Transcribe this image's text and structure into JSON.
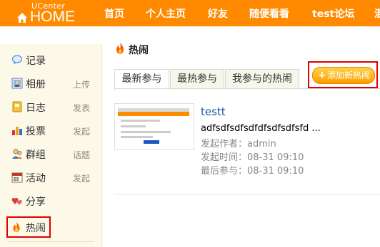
{
  "header": {
    "logo_small": "UCenter",
    "logo_big": "HOME",
    "nav": [
      {
        "label": "首页"
      },
      {
        "label": "个人主页"
      },
      {
        "label": "好友"
      },
      {
        "label": "随便看看"
      },
      {
        "label": "test论坛"
      },
      {
        "label": "混"
      }
    ]
  },
  "sidebar": {
    "items": [
      {
        "label": "记录",
        "sub": "",
        "icon": "speech-bubble-icon"
      },
      {
        "label": "相册",
        "sub": "上传",
        "icon": "photo-icon"
      },
      {
        "label": "日志",
        "sub": "发表",
        "icon": "notebook-icon"
      },
      {
        "label": "投票",
        "sub": "发起",
        "icon": "bar-chart-icon"
      },
      {
        "label": "群组",
        "sub": "话题",
        "icon": "group-icon"
      },
      {
        "label": "活动",
        "sub": "发起",
        "icon": "calendar-icon"
      },
      {
        "label": "分享",
        "sub": "",
        "icon": "hearts-icon"
      },
      {
        "label": "热闹",
        "sub": "",
        "icon": "flame-icon"
      }
    ]
  },
  "main": {
    "title": "热闹",
    "tabs": [
      {
        "label": "最新参与"
      },
      {
        "label": "最热参与"
      },
      {
        "label": "我参与的热闹"
      }
    ],
    "add_button": "添加新热闹",
    "post": {
      "title": "testt",
      "body": "adfsdfsdfsdfdfsdfsdfsfd ...",
      "author": "发起作者：admin",
      "created": "发起时间：08-31 09:10",
      "last": "最后参与：08-31 09:10"
    }
  },
  "colors": {
    "header_bg": "#ff8a00",
    "sidebar_bg": "#fdf9e8",
    "highlight_border": "#e00000",
    "link": "#1a57a7"
  }
}
